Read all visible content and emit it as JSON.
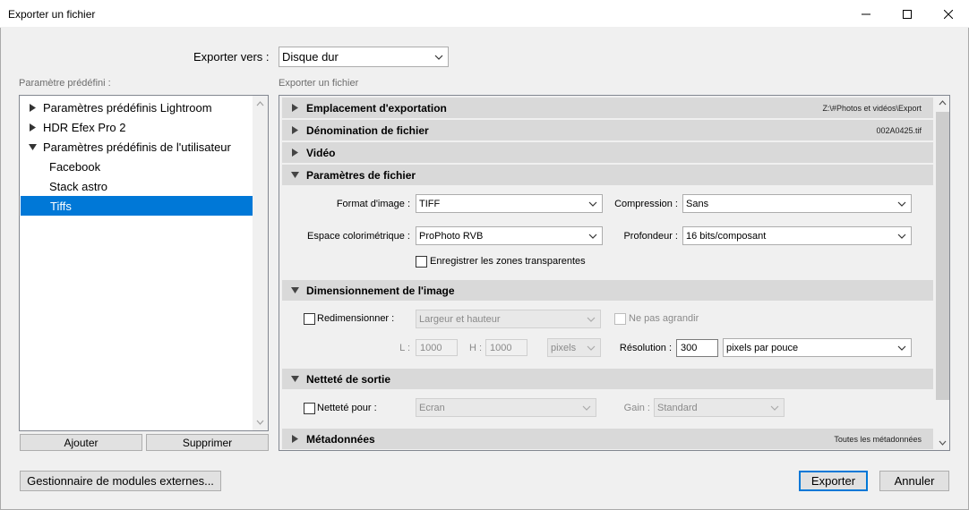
{
  "window": {
    "title": "Exporter un fichier"
  },
  "export_to": {
    "label": "Exporter vers :",
    "value": "Disque dur"
  },
  "presets": {
    "caption": "Paramètre prédéfini :",
    "items": [
      {
        "label": "Paramètres prédéfinis Lightroom"
      },
      {
        "label": "HDR Efex Pro 2"
      },
      {
        "label": "Paramètres prédéfinis de l'utilisateur"
      },
      {
        "label": "Facebook"
      },
      {
        "label": "Stack astro"
      },
      {
        "label": "Tiffs"
      }
    ],
    "add_label": "Ajouter",
    "remove_label": "Supprimer"
  },
  "export_panel": {
    "caption": "Exporter un fichier",
    "sections": {
      "location": {
        "title": "Emplacement d'exportation",
        "summary": "Z:\\#Photos et vidéos\\Export"
      },
      "naming": {
        "title": "Dénomination de fichier",
        "summary": "002A0425.tif"
      },
      "video": {
        "title": "Vidéo"
      },
      "file_settings": {
        "title": "Paramètres de fichier"
      },
      "sizing": {
        "title": "Dimensionnement de l'image"
      },
      "sharpening": {
        "title": "Netteté de sortie"
      },
      "metadata": {
        "title": "Métadonnées",
        "summary": "Toutes les métadonnées"
      }
    },
    "file_settings": {
      "format_label": "Format d'image :",
      "format_value": "TIFF",
      "compression_label": "Compression :",
      "compression_value": "Sans",
      "colorspace_label": "Espace colorimétrique :",
      "colorspace_value": "ProPhoto RVB",
      "depth_label": "Profondeur :",
      "depth_value": "16 bits/composant",
      "transparency_label": "Enregistrer les zones transparentes"
    },
    "sizing": {
      "resize_label": "Redimensionner :",
      "resize_mode": "Largeur et hauteur",
      "no_enlarge_label": "Ne pas agrandir",
      "width_label": "L :",
      "width_value": "1000",
      "height_label": "H :",
      "height_value": "1000",
      "unit_value": "pixels",
      "resolution_label": "Résolution :",
      "resolution_value": "300",
      "resolution_unit": "pixels par pouce"
    },
    "sharpening": {
      "sharpen_label": "Netteté pour :",
      "sharpen_value": "Ecran",
      "amount_label": "Gain :",
      "amount_value": "Standard"
    }
  },
  "footer": {
    "plugins_label": "Gestionnaire de modules externes...",
    "export_label": "Exporter",
    "cancel_label": "Annuler"
  }
}
